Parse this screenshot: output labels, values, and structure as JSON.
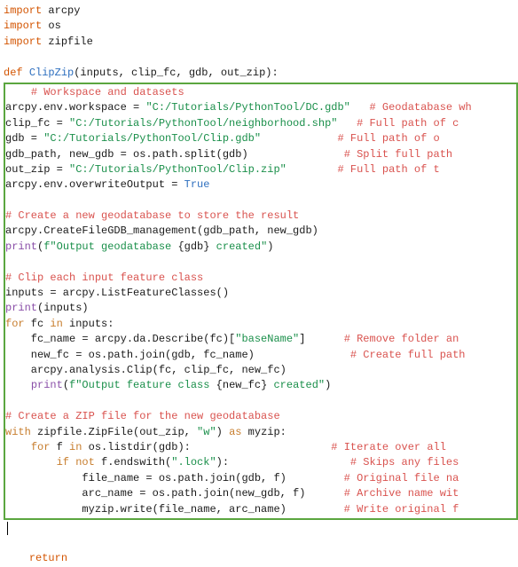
{
  "lines": {
    "l1a": "import",
    "l1b": " arcpy",
    "l2a": "import",
    "l2b": " os",
    "l3a": "import",
    "l3b": " zipfile",
    "l5a": "def ",
    "l5b": "ClipZip",
    "l5c": "(inputs, clip_fc, gdb, out_zip):",
    "l6a": "    ",
    "l6b": "# Workspace and datasets",
    "l7a": "arcpy.env.workspace = ",
    "l7b": "\"C:/Tutorials/PythonTool/DC.gdb\"",
    "l7c": "   ",
    "l7d": "# Geodatabase wh",
    "l8a": "clip_fc = ",
    "l8b": "\"C:/Tutorials/PythonTool/neighborhood.shp\"",
    "l8c": "   ",
    "l8d": "# Full path of c",
    "l9a": "gdb = ",
    "l9b": "\"C:/Tutorials/PythonTool/Clip.gdb\"",
    "l9c": "            ",
    "l9d": "# Full path of o",
    "l10a": "gdb_path, new_gdb = os.path.split(gdb)",
    "l10b": "               ",
    "l10c": "# Split full path",
    "l11a": "out_zip = ",
    "l11b": "\"C:/Tutorials/PythonTool/Clip.zip\"",
    "l11c": "        ",
    "l11d": "# Full path of t",
    "l12a": "arcpy.env.overwriteOutput = ",
    "l12b": "True",
    "l14a": "# Create a new geodatabase to store the result",
    "l15a": "arcpy.CreateFileGDB_management(gdb_path, new_gdb)",
    "l16a": "print",
    "l16b": "(",
    "l16c": "f\"Output geodatabase ",
    "l16d": "{gdb}",
    "l16e": " created\"",
    "l16f": ")",
    "l18a": "# Clip each input feature class",
    "l19a": "inputs = arcpy.ListFeatureClasses()",
    "l20a": "print",
    "l20b": "(inputs)",
    "l21a": "for",
    "l21b": " fc ",
    "l21c": "in",
    "l21d": " inputs:",
    "l22a": "    fc_name = arcpy.da.Describe(fc)[",
    "l22b": "\"baseName\"",
    "l22c": "]",
    "l22d": "      ",
    "l22e": "# Remove folder an",
    "l23a": "    new_fc = os.path.join(gdb, fc_name)",
    "l23b": "               ",
    "l23c": "# Create full path",
    "l24a": "    arcpy.analysis.Clip(fc, clip_fc, new_fc)",
    "l25a": "    ",
    "l25b": "print",
    "l25c": "(",
    "l25d": "f\"Output feature class ",
    "l25e": "{new_fc}",
    "l25f": " created\"",
    "l25g": ")",
    "l27a": "# Create a ZIP file for the new geodatabase",
    "l28a": "with",
    "l28b": " zipfile.ZipFile(out_zip, ",
    "l28c": "\"w\"",
    "l28d": ") ",
    "l28e": "as",
    "l28f": " myzip:",
    "l29a": "    ",
    "l29b": "for",
    "l29c": " f ",
    "l29d": "in",
    "l29e": " os.listdir(gdb):",
    "l29f": "                      ",
    "l29g": "# Iterate over all",
    "l30a": "        ",
    "l30b": "if",
    "l30c": " ",
    "l30d": "not",
    "l30e": " f.endswith(",
    "l30f": "\".lock\"",
    "l30g": "):",
    "l30h": "                   ",
    "l30i": "# Skips any files",
    "l31a": "            file_name = os.path.join(gdb, f)",
    "l31b": "         ",
    "l31c": "# Original file na",
    "l32a": "            arc_name = os.path.join(new_gdb, f)",
    "l32b": "      ",
    "l32c": "# Archive name wit",
    "l33a": "            myzip.write(file_name, arc_name)",
    "l33b": "         ",
    "l33c": "# Write original f",
    "l36a": "    ",
    "l36b": "return"
  }
}
